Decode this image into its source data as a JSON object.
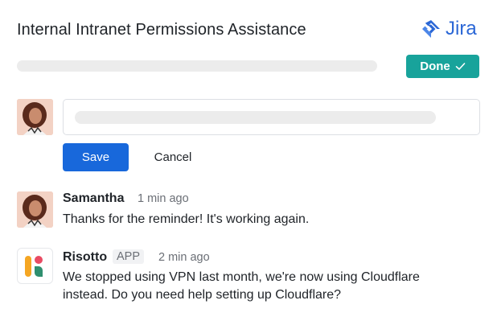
{
  "header": {
    "title": "Internal Intranet Permissions Assistance",
    "brand_name": "Jira",
    "brand_icon": "jira-logo-icon",
    "brand_color": "#2b67d6"
  },
  "status": {
    "done_label": "Done",
    "done_icon": "check-icon",
    "done_color": "#18a39b"
  },
  "composer": {
    "save_label": "Save",
    "cancel_label": "Cancel",
    "save_color": "#1868db"
  },
  "comments": [
    {
      "author": "Samantha",
      "time": "1 min ago",
      "text": "Thanks for the reminder! It's working again."
    },
    {
      "author": "Risotto",
      "badge": "APP",
      "time": "2 min ago",
      "text_line1": "We stopped using VPN last month, we're now using Cloudflare",
      "text_line2": "instead. Do you need help setting up Cloudflare?"
    }
  ]
}
